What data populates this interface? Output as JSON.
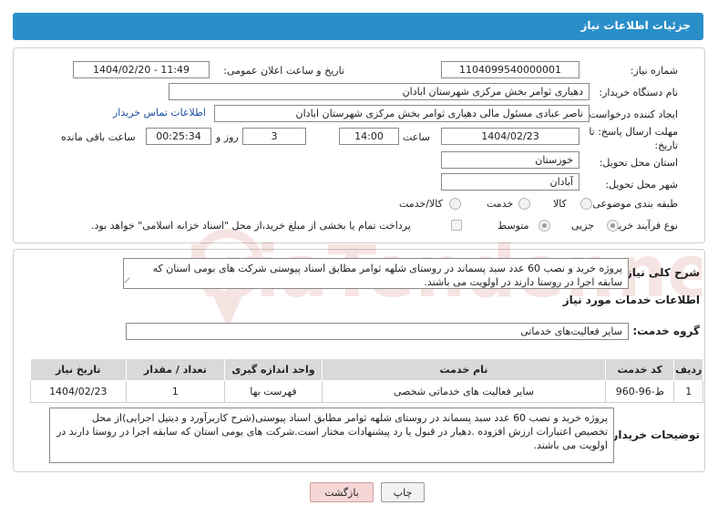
{
  "header": {
    "title": "جزئیات اطلاعات نیاز"
  },
  "fields": {
    "need_number_label": "شماره نیاز:",
    "need_number": "1104099540000001",
    "announce_label": "تاریخ و ساعت اعلان عمومی:",
    "announce_value": "1404/02/20 - 11:49",
    "buyer_org_label": "نام دستگاه خریدار:",
    "buyer_org": "دهیاری ثوامر بخش مرکزی شهرستان ابادان",
    "creator_label": "ایجاد کننده درخواست:",
    "creator": "ناصر عبادی مسئول مالی دهیاری ثوامر بخش مرکزی شهرستان ابادان",
    "contact_link": "اطلاعات تماس خریدار",
    "deadline_label_1": "مهلت ارسال پاسخ: تا",
    "deadline_label_2": "تاریخ:",
    "deadline_date": "1404/02/23",
    "time_label": "ساعت",
    "deadline_time": "14:00",
    "days_value": "3",
    "days_label": "روز و",
    "remaining_time": "00:25:34",
    "remaining_label": "ساعت باقی مانده",
    "province_label": "استان محل تحویل:",
    "province": "خوزستان",
    "city_label": "شهر محل تحویل:",
    "city": "آبادان",
    "category_label": "طبقه بندی موضوعی:",
    "category_options": [
      "کالا",
      "خدمت",
      "کالا/خدمت"
    ],
    "process_label": "نوع فرآیند خرید :",
    "process_options": [
      "جزیی",
      "متوسط"
    ],
    "payment_note": "پرداخت تمام یا بخشی از مبلغ خرید،از محل \"اسناد خزانه اسلامی\" خواهد بود."
  },
  "description": {
    "label": "شرح کلی نیاز:",
    "text": "پروژه خرید و نصب 60 عدد سبد پسماند در روستای شلهه ثوامر مطابق اسناد پیوستی شرکت های بومی استان که سابقه اجرا در روستا دارند در اولویت می باشند."
  },
  "services": {
    "section_title": "اطلاعات خدمات مورد نیاز",
    "group_label": "گروه خدمت:",
    "group_value": "سایر فعالیت‌های خدماتی",
    "columns": [
      "ردیف",
      "کد خدمت",
      "نام خدمت",
      "واحد اندازه گیری",
      "تعداد / مقدار",
      "تاریخ نیاز"
    ],
    "rows": [
      {
        "index": "1",
        "code": "ط-96-960",
        "name": "سایر فعالیت های خدماتی شخصی",
        "unit": "فهرست بها",
        "qty": "1",
        "date": "1404/02/23"
      }
    ]
  },
  "buyer_notes": {
    "label": "توضیحات خریدار:",
    "text": "پروژه خرید و نصب 60 عدد سبد پسماند در روستای شلهه ثوامر مطابق اسناد پیوستی(شرح کاربرآورد و دیتیل اجرایی)از محل تخصیص اعتبارات ارزش افزوده .دهیار در قبول یا رد پیشنهادات مختار است.شرکت های بومی استان که سابقه اجرا در روستا دارند در اولویت می باشند."
  },
  "buttons": {
    "print": "چاپ",
    "back": "بازگشت"
  },
  "watermark": {
    "text": "AriaTender.neT"
  },
  "colors": {
    "header": "#2a8fc9",
    "back_button": "#f6d7d7",
    "link": "#1a4fa0",
    "watermark": "#c0392b"
  }
}
